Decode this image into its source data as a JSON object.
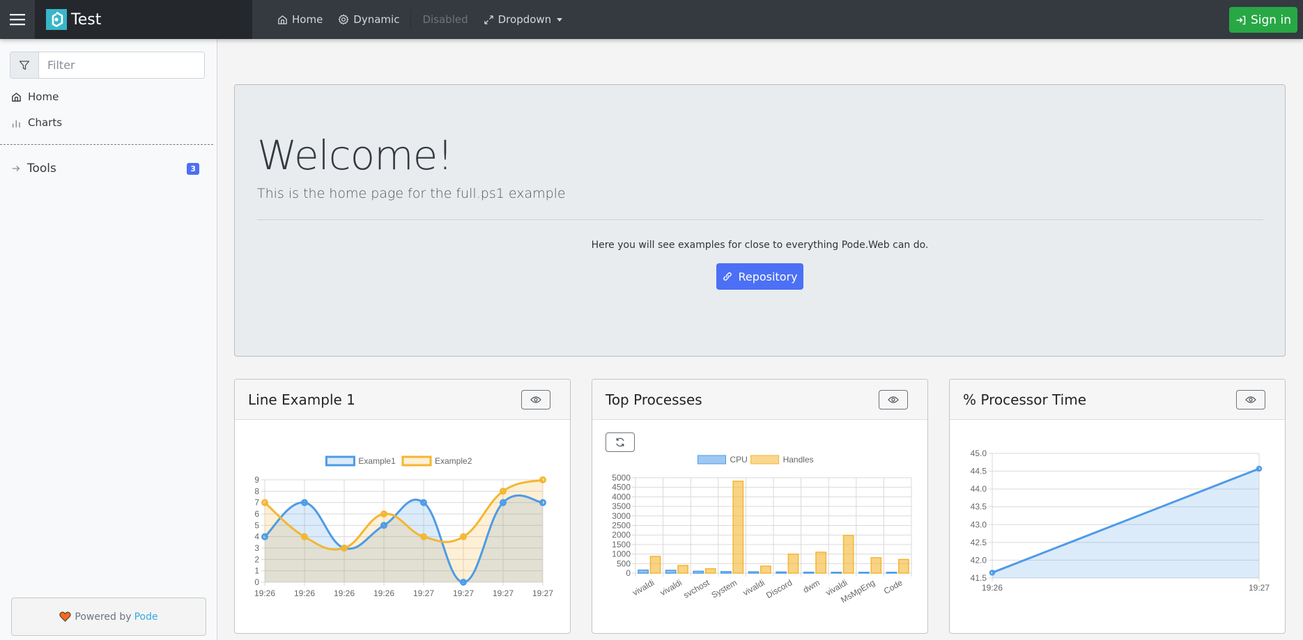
{
  "navbar": {
    "brand_title": "Test",
    "links": [
      {
        "label": "Home",
        "icon": "home-icon",
        "disabled": false
      },
      {
        "label": "Dynamic",
        "icon": "gear-icon",
        "disabled": false
      },
      {
        "label": "Disabled",
        "icon": null,
        "disabled": true
      },
      {
        "label": "Dropdown",
        "icon": "expand-arrows-icon",
        "disabled": false,
        "dropdown": true
      }
    ],
    "signin_label": "Sign in"
  },
  "sidebar": {
    "filter_placeholder": "Filter",
    "items": [
      {
        "label": "Home",
        "icon": "home-icon"
      },
      {
        "label": "Charts",
        "icon": "bar-chart-icon"
      }
    ],
    "groups": [
      {
        "label": "Tools",
        "icon": "arrow-right-icon",
        "badge": "3"
      }
    ],
    "footer": {
      "prefix": "Powered by",
      "link": "Pode",
      "icon": "heart-icon"
    }
  },
  "jumbotron": {
    "title": "Welcome!",
    "lead": "This is the home page for the full.ps1 example",
    "text": "Here you will see examples for close to everything Pode.Web can do.",
    "button_label": "Repository",
    "button_icon": "link-icon"
  },
  "colors": {
    "navbar": "#343a40",
    "brand": "#38b6c9",
    "primary": "#4b70f5",
    "success": "#28a745",
    "series_blue": "#4e9be6",
    "series_yellow": "#f4b631"
  },
  "cards": [
    {
      "title": "Line Example 1",
      "action_icon": "eye-icon"
    },
    {
      "title": "Top Processes",
      "action_icon": "eye-icon",
      "refresh_icon": "refresh-icon"
    },
    {
      "title": "% Processor Time",
      "action_icon": "eye-icon"
    }
  ],
  "chart_data": [
    {
      "type": "line",
      "title": "Line Example 1",
      "categories": [
        "19:26",
        "19:26",
        "19:26",
        "19:26",
        "19:27",
        "19:27",
        "19:27",
        "19:27"
      ],
      "series": [
        {
          "name": "Example1",
          "values": [
            4,
            7,
            3,
            5,
            7,
            0,
            7,
            7
          ],
          "color": "#4e9be6"
        },
        {
          "name": "Example2",
          "values": [
            7,
            4,
            3,
            6,
            4,
            4,
            8,
            9
          ],
          "color": "#f4b631"
        }
      ],
      "ylim": [
        0,
        9
      ],
      "yticks": [
        0,
        1,
        2,
        3,
        4,
        5,
        6,
        7,
        8,
        9
      ],
      "fill": true,
      "smooth": true,
      "grid": true,
      "legend": "top"
    },
    {
      "type": "bar",
      "title": "Top Processes",
      "categories": [
        "vivaldi",
        "vivaldi",
        "svchost",
        "System",
        "vivaldi",
        "Discord",
        "dwm",
        "vivaldi",
        "MsMpEng",
        "Code"
      ],
      "series": [
        {
          "name": "CPU",
          "values": [
            160,
            150,
            100,
            80,
            70,
            60,
            50,
            45,
            45,
            45
          ],
          "color": "#4e9be6"
        },
        {
          "name": "Handles",
          "values": [
            880,
            400,
            230,
            4820,
            370,
            1000,
            1100,
            1980,
            810,
            720
          ],
          "color": "#f4b631"
        }
      ],
      "ylim": [
        0,
        5000
      ],
      "yticks": [
        0,
        500,
        1000,
        1500,
        2000,
        2500,
        3000,
        3500,
        4000,
        4500,
        5000
      ],
      "grid": true,
      "legend": "top",
      "xlabel_rotation": "angled"
    },
    {
      "type": "area",
      "title": "% Processor Time",
      "categories": [
        "19:26",
        "19:27"
      ],
      "series": [
        {
          "name": "% Processor Time",
          "values": [
            41.65,
            44.57
          ],
          "color": "#4e9be6"
        }
      ],
      "ylim": [
        41.5,
        45.0
      ],
      "yticks": [
        41.5,
        42.0,
        42.5,
        43.0,
        43.5,
        44.0,
        44.5,
        45.0
      ],
      "grid": true,
      "legend": "none"
    }
  ]
}
